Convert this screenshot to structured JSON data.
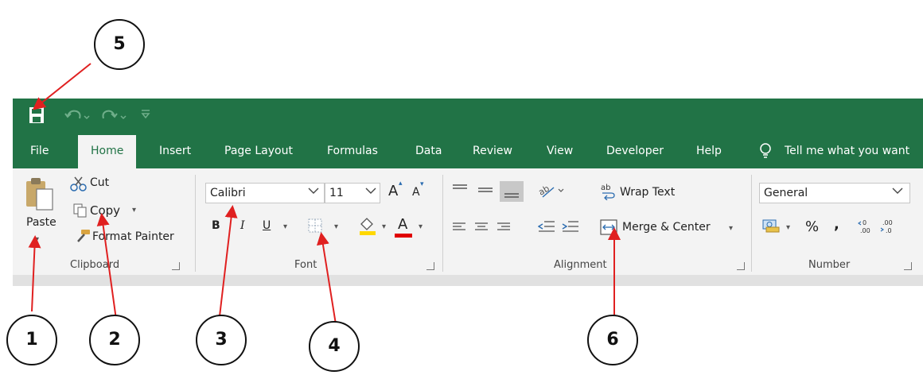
{
  "quick_access": {
    "save_icon": "save-icon",
    "undo_icon": "undo-icon",
    "redo_icon": "redo-icon",
    "customize_icon": "customize-qat-icon"
  },
  "tabs": [
    {
      "label": "File"
    },
    {
      "label": "Home"
    },
    {
      "label": "Insert"
    },
    {
      "label": "Page Layout"
    },
    {
      "label": "Formulas"
    },
    {
      "label": "Data"
    },
    {
      "label": "Review"
    },
    {
      "label": "View"
    },
    {
      "label": "Developer"
    },
    {
      "label": "Help"
    }
  ],
  "tell_me": {
    "icon": "lightbulb-icon",
    "label": "Tell me what you want"
  },
  "clipboard": {
    "paste_label": "Paste",
    "cut_label": "Cut",
    "copy_label": "Copy",
    "format_painter_label": "Format Painter",
    "group_label": "Clipboard"
  },
  "font": {
    "font_name": "Calibri",
    "font_size": "11",
    "grow_label": "A",
    "shrink_label": "A",
    "bold_label": "B",
    "italic_label": "I",
    "underline_label": "U",
    "font_color_label": "A",
    "group_label": "Font"
  },
  "alignment": {
    "wrap_text_label": "Wrap Text",
    "merge_center_label": "Merge & Center",
    "group_label": "Alignment"
  },
  "number": {
    "format_value": "General",
    "percent_label": "%",
    "comma_label": ",",
    "group_label": "Number"
  },
  "callouts": [
    {
      "label": "1"
    },
    {
      "label": "2"
    },
    {
      "label": "3"
    },
    {
      "label": "4"
    },
    {
      "label": "5"
    },
    {
      "label": "6"
    }
  ],
  "colors": {
    "excel_green": "#217346",
    "ribbon_bg": "#f3f3f3",
    "highlight_yellow": "#ffd800",
    "font_red": "#e00000",
    "arrow_red": "#e02020"
  }
}
